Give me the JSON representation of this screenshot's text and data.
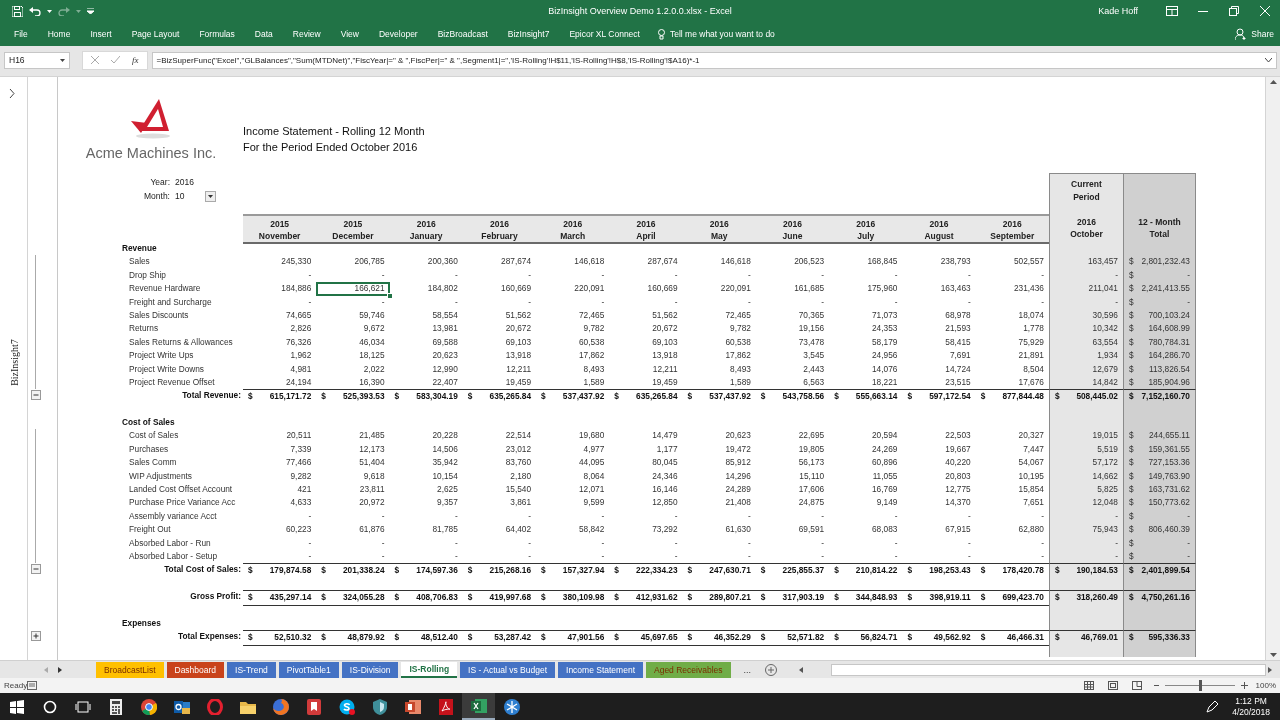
{
  "window": {
    "title": "BizInsight Overview Demo 1.2.0.0.xlsx  -  Excel",
    "user": "Kade Hoff"
  },
  "ribbon_tabs": [
    "File",
    "Home",
    "Insert",
    "Page Layout",
    "Formulas",
    "Data",
    "Review",
    "View",
    "Developer",
    "BizBroadcast",
    "BizInsight7",
    "Epicor XL Connect"
  ],
  "tell_me": "Tell me what you want to do",
  "share": "Share",
  "formula_bar": {
    "name_box": "H16",
    "function_label": "fx",
    "formula": "=BizSuperFunc(\"Excel\",\"GLBalances\",\"Sum(MTDNet)\",\"FiscYear|=\" & \",FiscPer|=\" & \",Segment1|=\",'IS-Rolling'!H$11,'IS-Rolling'!H$8,'IS-Rolling'!$A16)*-1"
  },
  "side_pane": {
    "title": "BizInsight7"
  },
  "report": {
    "company": "Acme Machines Inc.",
    "titles": [
      "Income Statement - Rolling 12 Month",
      "For the Period Ended October 2016"
    ],
    "params": [
      {
        "label": "Year:",
        "value": "2016",
        "dropdown": false
      },
      {
        "label": "Month:",
        "value": "10",
        "dropdown": true
      }
    ],
    "current_period_label": [
      "Current",
      "Period"
    ],
    "currency_symbol": "$",
    "columns": [
      {
        "year": "2015",
        "month": "November"
      },
      {
        "year": "2015",
        "month": "December"
      },
      {
        "year": "2016",
        "month": "January"
      },
      {
        "year": "2016",
        "month": "February"
      },
      {
        "year": "2016",
        "month": "March"
      },
      {
        "year": "2016",
        "month": "April"
      },
      {
        "year": "2016",
        "month": "May"
      },
      {
        "year": "2016",
        "month": "June"
      },
      {
        "year": "2016",
        "month": "July"
      },
      {
        "year": "2016",
        "month": "August"
      },
      {
        "year": "2016",
        "month": "September"
      }
    ],
    "current_column": {
      "year": "2016",
      "month": "October"
    },
    "total_column": [
      "12 - Month",
      "Total"
    ],
    "rows": [
      {
        "kind": "section",
        "label": "Revenue"
      },
      {
        "kind": "line",
        "label": "Sales",
        "values": [
          "245,330",
          "206,785",
          "200,360",
          "287,674",
          "146,618",
          "287,674",
          "146,618",
          "206,523",
          "168,845",
          "238,793",
          "502,557"
        ],
        "current": "163,457",
        "total": "2,801,232.43"
      },
      {
        "kind": "line",
        "label": "Drop Ship",
        "values": [
          "-",
          "-",
          "-",
          "-",
          "-",
          "-",
          "-",
          "-",
          "-",
          "-",
          "-"
        ],
        "current": "-",
        "total": "-"
      },
      {
        "kind": "line",
        "label": "Revenue Hardware",
        "values": [
          "184,886",
          "166,621",
          "184,802",
          "160,669",
          "220,091",
          "160,669",
          "220,091",
          "161,685",
          "175,960",
          "163,463",
          "231,436"
        ],
        "selected": [
          false,
          true,
          false,
          false,
          false,
          false,
          false,
          false,
          false,
          false,
          false
        ],
        "current": "211,041",
        "total": "2,241,413.55"
      },
      {
        "kind": "line",
        "label": "Freight and Surcharge",
        "values": [
          "-",
          "-",
          "-",
          "-",
          "-",
          "-",
          "-",
          "-",
          "-",
          "-",
          "-"
        ],
        "current": "-",
        "total": "-"
      },
      {
        "kind": "line",
        "label": "Sales Discounts",
        "values": [
          "74,665",
          "59,746",
          "58,554",
          "51,562",
          "72,465",
          "51,562",
          "72,465",
          "70,365",
          "71,073",
          "68,978",
          "18,074"
        ],
        "current": "30,596",
        "total": "700,103.24"
      },
      {
        "kind": "line",
        "label": "Returns",
        "values": [
          "2,826",
          "9,672",
          "13,981",
          "20,672",
          "9,782",
          "20,672",
          "9,782",
          "19,156",
          "24,353",
          "21,593",
          "1,778"
        ],
        "current": "10,342",
        "total": "164,608.99"
      },
      {
        "kind": "line",
        "label": "Sales Returns & Allowances",
        "values": [
          "76,326",
          "46,034",
          "69,588",
          "69,103",
          "60,538",
          "69,103",
          "60,538",
          "73,478",
          "58,179",
          "58,415",
          "75,929"
        ],
        "current": "63,554",
        "total": "780,784.31"
      },
      {
        "kind": "line",
        "label": "Project Write Ups",
        "values": [
          "1,962",
          "18,125",
          "20,623",
          "13,918",
          "17,862",
          "13,918",
          "17,862",
          "3,545",
          "24,956",
          "7,691",
          "21,891"
        ],
        "current": "1,934",
        "total": "164,286.70"
      },
      {
        "kind": "line",
        "label": "Project Write Downs",
        "values": [
          "4,981",
          "2,022",
          "12,990",
          "12,211",
          "8,493",
          "12,211",
          "8,493",
          "2,443",
          "14,076",
          "14,724",
          "8,504"
        ],
        "current": "12,679",
        "total": "113,826.54"
      },
      {
        "kind": "line",
        "label": "Project Revenue Offset",
        "values": [
          "24,194",
          "16,390",
          "22,407",
          "19,459",
          "1,589",
          "19,459",
          "1,589",
          "6,563",
          "18,221",
          "23,515",
          "17,676"
        ],
        "current": "14,842",
        "total": "185,904.96"
      },
      {
        "kind": "total",
        "label": "Total Revenue:",
        "expanded": true,
        "values": [
          "615,171.72",
          "525,393.53",
          "583,304.19",
          "635,265.84",
          "537,437.92",
          "635,265.84",
          "537,437.92",
          "543,758.56",
          "555,663.14",
          "597,172.54",
          "877,844.48"
        ],
        "current": "508,445.02",
        "total": "7,152,160.70"
      },
      {
        "kind": "section",
        "label": "Cost of Sales"
      },
      {
        "kind": "line",
        "label": "Cost of Sales",
        "values": [
          "20,511",
          "21,485",
          "20,228",
          "22,514",
          "19,680",
          "14,479",
          "20,623",
          "22,695",
          "20,594",
          "22,503",
          "20,327"
        ],
        "current": "19,015",
        "total": "244,655.11"
      },
      {
        "kind": "line",
        "label": "Purchases",
        "values": [
          "7,339",
          "12,173",
          "14,506",
          "23,012",
          "4,977",
          "1,177",
          "19,472",
          "19,805",
          "24,269",
          "19,667",
          "7,447"
        ],
        "current": "5,519",
        "total": "159,361.55"
      },
      {
        "kind": "line",
        "label": "Sales Comm",
        "values": [
          "77,466",
          "51,404",
          "35,942",
          "83,760",
          "44,095",
          "80,045",
          "85,912",
          "56,173",
          "60,896",
          "40,220",
          "54,067"
        ],
        "current": "57,172",
        "total": "727,153.36"
      },
      {
        "kind": "line",
        "label": "WIP Adjustments",
        "values": [
          "9,282",
          "9,618",
          "10,154",
          "2,180",
          "8,064",
          "24,346",
          "14,296",
          "15,110",
          "11,055",
          "20,803",
          "10,195"
        ],
        "current": "14,662",
        "total": "149,763.90"
      },
      {
        "kind": "line",
        "label": "Landed Cost Offset Account",
        "values": [
          "421",
          "23,811",
          "2,625",
          "15,540",
          "12,071",
          "16,146",
          "24,289",
          "17,606",
          "16,769",
          "12,775",
          "15,854"
        ],
        "current": "5,825",
        "total": "163,731.62"
      },
      {
        "kind": "line",
        "label": "Purchase Price Variance Acc",
        "values": [
          "4,633",
          "20,972",
          "9,357",
          "3,861",
          "9,599",
          "12,850",
          "21,408",
          "24,875",
          "9,149",
          "14,370",
          "7,651"
        ],
        "current": "12,048",
        "total": "150,773.62"
      },
      {
        "kind": "line",
        "label": "Assembly variance Acct",
        "values": [
          "-",
          "-",
          "-",
          "-",
          "-",
          "-",
          "-",
          "-",
          "-",
          "-",
          "-"
        ],
        "current": "-",
        "total": "-"
      },
      {
        "kind": "line",
        "label": "Freight Out",
        "values": [
          "60,223",
          "61,876",
          "81,785",
          "64,402",
          "58,842",
          "73,292",
          "61,630",
          "69,591",
          "68,083",
          "67,915",
          "62,880"
        ],
        "current": "75,943",
        "total": "806,460.39"
      },
      {
        "kind": "line",
        "label": "Absorbed Labor - Run",
        "values": [
          "-",
          "-",
          "-",
          "-",
          "-",
          "-",
          "-",
          "-",
          "-",
          "-",
          "-"
        ],
        "current": "-",
        "total": "-"
      },
      {
        "kind": "line",
        "label": "Absorbed Labor - Setup",
        "values": [
          "-",
          "-",
          "-",
          "-",
          "-",
          "-",
          "-",
          "-",
          "-",
          "-",
          "-"
        ],
        "current": "-",
        "total": "-"
      },
      {
        "kind": "total",
        "label": "Total Cost of Sales:",
        "expanded": true,
        "values": [
          "179,874.58",
          "201,338.24",
          "174,597.36",
          "215,268.16",
          "157,327.94",
          "222,334.23",
          "247,630.71",
          "225,855.37",
          "210,814.22",
          "198,253.43",
          "178,420.78"
        ],
        "current": "190,184.53",
        "total": "2,401,899.54"
      },
      {
        "kind": "grand",
        "label": "Gross Profit:",
        "values": [
          "435,297.14",
          "324,055.28",
          "408,706.83",
          "419,997.68",
          "380,109.98",
          "412,931.62",
          "289,807.21",
          "317,903.19",
          "344,848.93",
          "398,919.11",
          "699,423.70"
        ],
        "current": "318,260.49",
        "total": "4,750,261.16"
      },
      {
        "kind": "section",
        "label": "Expenses"
      },
      {
        "kind": "grand",
        "label": "Total Expenses:",
        "expanded": false,
        "values": [
          "52,510.32",
          "48,879.92",
          "48,512.40",
          "53,287.42",
          "47,901.56",
          "45,697.65",
          "46,352.29",
          "52,571.82",
          "56,824.71",
          "49,562.92",
          "46,466.31"
        ],
        "current": "46,769.01",
        "total": "595,336.33"
      }
    ]
  },
  "sheet_tabs": [
    {
      "label": "BroadcastList",
      "color": "#ffc000",
      "selected": false
    },
    {
      "label": "Dashboard",
      "color": "#c9431b",
      "selected": false
    },
    {
      "label": "IS-Trend",
      "color": "#4472c4",
      "selected": false
    },
    {
      "label": "PivotTable1",
      "color": "#4472c4",
      "selected": false
    },
    {
      "label": "IS-Division",
      "color": "#4472c4",
      "selected": false
    },
    {
      "label": "IS-Rolling",
      "color": "#217346",
      "selected": true
    },
    {
      "label": "IS - Actual vs Budget",
      "color": "#4472c4",
      "selected": false
    },
    {
      "label": "Income Statement",
      "color": "#4472c4",
      "selected": false
    },
    {
      "label": "Aged Receivables",
      "color": "#70ad47",
      "selected": false
    }
  ],
  "more_tabs": "...",
  "status_bar": {
    "status": "Ready",
    "zoom": "100%",
    "zoom_slider": {
      "level": 0.5
    }
  },
  "taskbar": {
    "apps": [
      {
        "kind": "start",
        "active": false
      },
      {
        "kind": "search",
        "active": false
      },
      {
        "kind": "taskview",
        "active": false
      },
      {
        "kind": "calculator",
        "active": false
      },
      {
        "kind": "browser",
        "active": false
      },
      {
        "kind": "mail",
        "active": false
      },
      {
        "kind": "ring",
        "active": false
      },
      {
        "kind": "folder",
        "active": false
      },
      {
        "kind": "globe",
        "active": false
      },
      {
        "kind": "bookmark",
        "active": false
      },
      {
        "kind": "chat",
        "active": false,
        "badge": true
      },
      {
        "kind": "shield",
        "active": false
      },
      {
        "kind": "slides",
        "active": false
      },
      {
        "kind": "pdf",
        "active": false
      },
      {
        "kind": "spreadsheet",
        "active": true
      },
      {
        "kind": "snowflake",
        "active": false
      }
    ],
    "time": "1:12 PM",
    "date": "4/20/2018"
  }
}
